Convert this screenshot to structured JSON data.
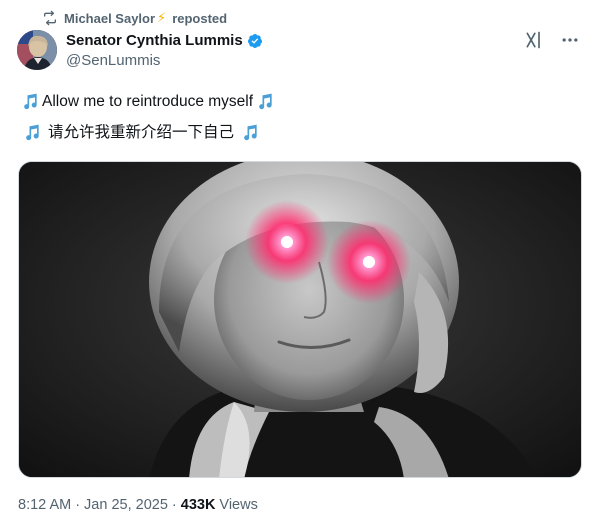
{
  "repost": {
    "reposter_name": "Michael Saylor",
    "reposter_emoji": "⚡",
    "label": "reposted"
  },
  "author": {
    "name": "Senator Cynthia Lummis",
    "handle": "@SenLummis",
    "verified": true
  },
  "tweet": {
    "line1": "Allow me to reintroduce myself",
    "line2": "请允许我重新介绍一下自己",
    "icons": [
      "musical-notes-icon"
    ]
  },
  "meta": {
    "time": "8:12 AM",
    "sep1": "·",
    "date": "Jan 25, 2025",
    "sep2": "·",
    "views_count": "433K",
    "views_label": "Views"
  },
  "colors": {
    "secondary_text": "#536471",
    "primary_text": "#0f1419",
    "verified_blue": "#1d9bf0",
    "laser_eye": "#ff2d6f"
  }
}
